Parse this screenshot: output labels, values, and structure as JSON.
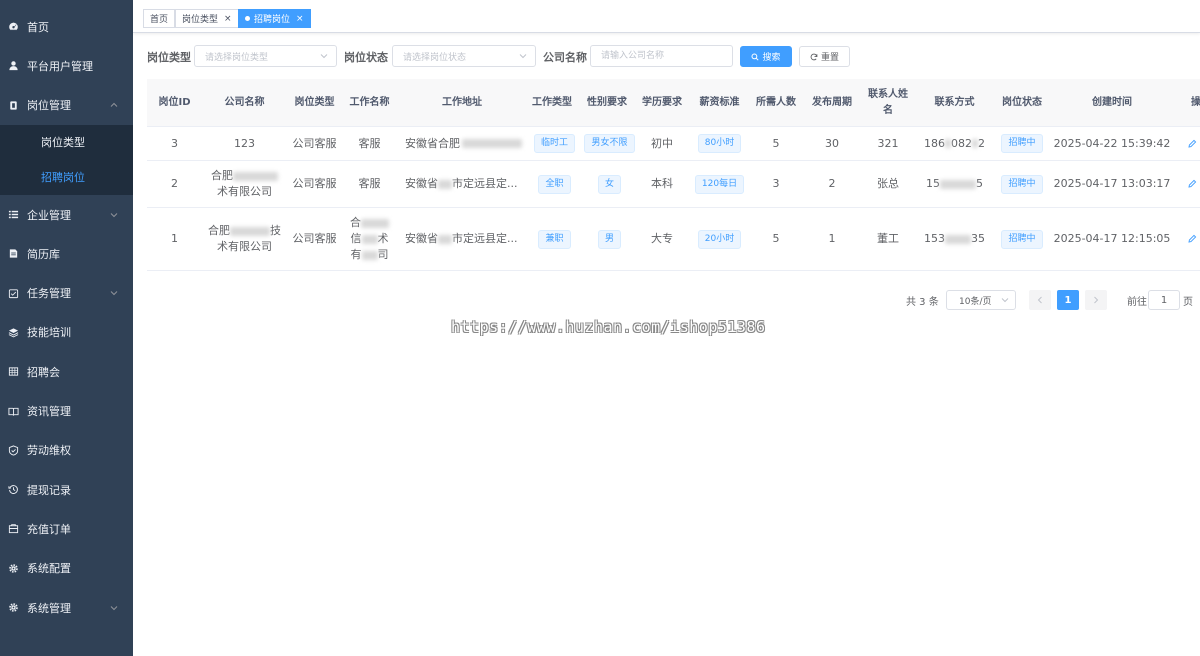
{
  "sidebar": {
    "items": [
      {
        "label": "首页",
        "icon": "dashboard-icon"
      },
      {
        "label": "平台用户管理",
        "icon": "user-icon"
      },
      {
        "label": "岗位管理",
        "icon": "post-icon",
        "expanded": true,
        "children": [
          {
            "label": "岗位类型",
            "active": false
          },
          {
            "label": "招聘岗位",
            "active": true
          }
        ]
      },
      {
        "label": "企业管理",
        "icon": "list-icon",
        "has_children": true
      },
      {
        "label": "简历库",
        "icon": "resume-icon"
      },
      {
        "label": "任务管理",
        "icon": "task-icon",
        "has_children": true
      },
      {
        "label": "技能培训",
        "icon": "layers-icon"
      },
      {
        "label": "招聘会",
        "icon": "table-icon"
      },
      {
        "label": "资讯管理",
        "icon": "book-icon"
      },
      {
        "label": "劳动维权",
        "icon": "shield-icon"
      },
      {
        "label": "提现记录",
        "icon": "history-icon"
      },
      {
        "label": "充值订单",
        "icon": "order-icon"
      },
      {
        "label": "系统配置",
        "icon": "gear-icon"
      },
      {
        "label": "系统管理",
        "icon": "gear-icon",
        "has_children": true
      }
    ]
  },
  "tags": [
    {
      "label": "首页",
      "closable": false,
      "active": false
    },
    {
      "label": "岗位类型",
      "closable": true,
      "active": false
    },
    {
      "label": "招聘岗位",
      "closable": true,
      "active": true
    }
  ],
  "filters": {
    "post_type_label": "岗位类型",
    "post_type_placeholder": "请选择岗位类型",
    "post_status_label": "岗位状态",
    "post_status_placeholder": "请选择岗位状态",
    "company_label": "公司名称",
    "company_placeholder": "请输入公司名称",
    "search_label": "搜索",
    "reset_label": "重置"
  },
  "table": {
    "columns": [
      "岗位ID",
      "公司名称",
      "岗位类型",
      "工作名称",
      "工作地址",
      "工作类型",
      "性别要求",
      "学历要求",
      "薪资标准",
      "所需人数",
      "发布周期",
      "联系人姓名",
      "联系方式",
      "岗位状态",
      "创建时间"
    ],
    "rows": [
      {
        "id": "3",
        "company": "123",
        "post_type": "公司客服",
        "job_name": "客服",
        "address": "安徽省合肥",
        "work_type": "临时工",
        "gender": "男女不限",
        "education": "初中",
        "salary": "80小时",
        "count": "5",
        "period": "30",
        "contact_name": "321",
        "phone_a": "186",
        "phone_b": "082",
        "phone_c": "2",
        "status": "招聘中",
        "created": "2025-04-22 15:39:42"
      },
      {
        "id": "2",
        "company_a": "合肥",
        "company_b": "术有限公司",
        "post_type": "公司客服",
        "job_name": "客服",
        "address": "安徽省",
        "address_b": "市定远县定...",
        "work_type": "全职",
        "gender": "女",
        "education": "本科",
        "salary": "120每日",
        "count": "3",
        "period": "2",
        "contact_name": "张总",
        "phone_a": "15",
        "phone_c": "5",
        "status": "招聘中",
        "created": "2025-04-17 13:03:17"
      },
      {
        "id": "1",
        "company_a": "合肥",
        "company_a2": "技",
        "company_b": "术有限公司",
        "post_type": "公司客服",
        "job_a": "合",
        "job_b": "信",
        "job_b2": "术",
        "job_c": "有",
        "job_c2": "司",
        "address": "安徽省",
        "address_b": "市定远县定...",
        "work_type": "兼职",
        "gender": "男",
        "education": "大专",
        "salary": "20小时",
        "count": "5",
        "period": "1",
        "contact_name": "董工",
        "phone_a": "153",
        "phone_c": "35",
        "status": "招聘中",
        "created": "2025-04-17 12:15:05"
      }
    ]
  },
  "pagination": {
    "total": "共 3 条",
    "page_size": "10条/页",
    "current_page": "1",
    "goto_label": "前往",
    "goto_value": "1",
    "page_suffix": "页"
  },
  "watermark": "https://www.huzhan.com/ishop51386",
  "colors": {
    "sidebar_bg": "#304156",
    "submenu_bg": "#1f2d3d",
    "primary": "#409eff",
    "active_tag": "#42b983"
  }
}
